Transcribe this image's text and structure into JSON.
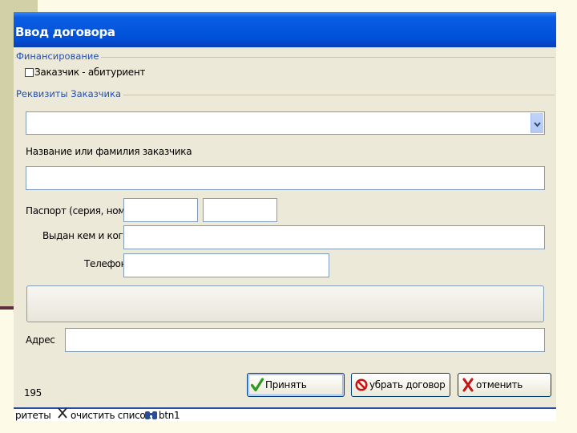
{
  "window": {
    "title": "Ввод договора"
  },
  "financing": {
    "group_label": "Финансирование",
    "checkbox_label": "Заказчик - абитуриент",
    "checked": false
  },
  "customer": {
    "group_label": "Реквизиты Заказчика",
    "select_value": "",
    "name_label": "Название или фамилия заказчика",
    "name_value": "",
    "passport_label": "Паспорт (серия, номер)",
    "passport_series": "",
    "passport_number": "",
    "issued_label": "Выдан кем и когда",
    "issued_value": "",
    "phone_label": "Телефон",
    "phone_value": "",
    "address_label": "Адрес",
    "address_value": ""
  },
  "footer": {
    "record_number": "195",
    "accept_label": "Принять",
    "remove_label": "убрать договор",
    "cancel_label": "отменить"
  },
  "statusbar": {
    "item1": "ритеты",
    "item2": "очистить список",
    "item3": "btn1"
  },
  "colors": {
    "title_bar": "#0050da",
    "dialog_bg": "#ece9d8",
    "group_label": "#1f4fb4",
    "accept_icon": "#2e9a1e",
    "remove_icon": "#c41414",
    "cancel_icon": "#c41414"
  },
  "icons": {
    "accept": "checkmark-icon",
    "remove": "no-entry-icon",
    "cancel": "x-icon",
    "clear": "x-icon",
    "btn1": "binoculars-icon"
  }
}
